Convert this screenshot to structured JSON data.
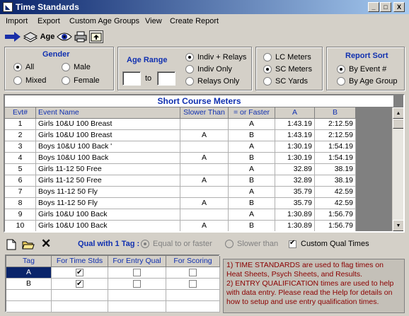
{
  "window": {
    "title": "Time Standards",
    "minimize": "_",
    "maximize": "□",
    "close": "X"
  },
  "menu": [
    "Import",
    "Export",
    "Custom Age Groups",
    "View",
    "Create Report"
  ],
  "toolbar": {
    "age_label": "Age"
  },
  "gender": {
    "title": "Gender",
    "options": [
      "All",
      "Male",
      "Mixed",
      "Female"
    ],
    "selected": "All"
  },
  "age_range": {
    "title": "Age Range",
    "from": "",
    "to_label": "to",
    "to": ""
  },
  "relay_filter": {
    "options": [
      "Indiv + Relays",
      "Indiv Only",
      "Relays Only"
    ],
    "selected": "Indiv + Relays"
  },
  "course": {
    "options": [
      "LC Meters",
      "SC Meters",
      "SC Yards"
    ],
    "selected": "SC Meters"
  },
  "report_sort": {
    "title": "Report Sort",
    "options": [
      "By Event #",
      "By Age Group"
    ],
    "selected": "By Event #"
  },
  "table": {
    "caption": "Short Course Meters",
    "columns": [
      "Evt#",
      "Event Name",
      "Slower Than",
      "= or Faster",
      "A",
      "B"
    ],
    "rows": [
      [
        "1",
        "Girls 10&U 100 Breast",
        "",
        "A",
        "1:43.19",
        "2:12.59"
      ],
      [
        "2",
        "Girls 10&U 100 Breast",
        "A",
        "B",
        "1:43.19",
        "2:12.59"
      ],
      [
        "3",
        "Boys 10&U 100 Back '",
        "",
        "A",
        "1:30.19",
        "1:54.19"
      ],
      [
        "4",
        "Boys 10&U 100 Back",
        "A",
        "B",
        "1:30.19",
        "1:54.19"
      ],
      [
        "5",
        "Girls 11-12 50 Free",
        "",
        "A",
        "32.89",
        "38.19"
      ],
      [
        "6",
        "Girls 11-12 50 Free",
        "A",
        "B",
        "32.89",
        "38.19"
      ],
      [
        "7",
        "Boys 11-12 50 Fly",
        "",
        "A",
        "35.79",
        "42.59"
      ],
      [
        "8",
        "Boys 11-12 50 Fly",
        "A",
        "B",
        "35.79",
        "42.59"
      ],
      [
        "9",
        "Girls 10&U 100 Back",
        "",
        "A",
        "1:30.89",
        "1:56.79"
      ],
      [
        "10",
        "Girls 10&U 100 Back",
        "A",
        "B",
        "1:30.89",
        "1:56.79"
      ]
    ]
  },
  "qual": {
    "title": "Qual with 1 Tag :",
    "options": [
      "Equal to or faster",
      "Slower than"
    ],
    "selected": "Equal to or faster",
    "custom_label": "Custom Qual Times",
    "custom_checked": true
  },
  "tags": {
    "columns": [
      "Tag",
      "For Time Stds",
      "For Entry Qual",
      "For Scoring"
    ],
    "rows": [
      {
        "tag": "A",
        "time_stds": true,
        "entry_qual": false,
        "scoring": false
      },
      {
        "tag": "B",
        "time_stds": true,
        "entry_qual": false,
        "scoring": false
      }
    ]
  },
  "info": {
    "line1": "1)  TIME STANDARDS are used to flag times on Heat Sheets, Psych Sheets, and Results.",
    "line2": "2)  ENTRY QUALIFICATION times are used to help with data entry. Please read the Help for details on how to setup and use entry qualification times."
  }
}
